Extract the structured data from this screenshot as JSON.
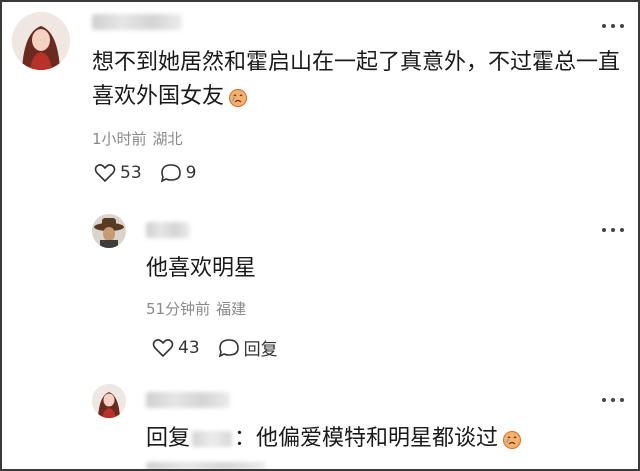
{
  "comments": [
    {
      "text_line1": "想不到她居然和霍启山在一起了真意外，不过霍总一直",
      "text_line2": "喜欢外国女友",
      "time": "1小时前",
      "location": "湖北",
      "likes": "53",
      "replies": "9",
      "avatar_icon": "woman-avatar"
    },
    {
      "text": "他喜欢明星",
      "time": "51分钟前",
      "location": "福建",
      "likes": "43",
      "reply_label": "回复",
      "avatar_icon": "cowboy-hat-avatar"
    },
    {
      "reply_prefix": "回复",
      "text": "：他偏爱模特和明星都谈过",
      "avatar_icon": "woman-avatar"
    }
  ],
  "icons": {
    "more": "more-dots-icon",
    "like": "heart-icon",
    "comment": "comment-bubble-icon",
    "emoji": "crying-emoji-icon"
  },
  "colors": {
    "meta": "#8a8a8a",
    "emoji": "#f0a04b"
  }
}
